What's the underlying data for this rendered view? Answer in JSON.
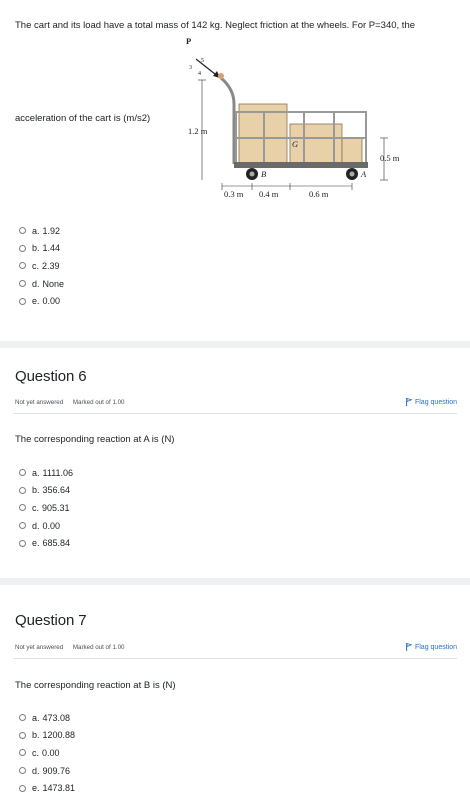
{
  "question5": {
    "text": "The cart and its load have a total mass of 142 kg. Neglect friction at the wheels. For P=340, the",
    "prompt": "acceleration of the cart is  (m/s2)",
    "answers": [
      {
        "letter": "a.",
        "value": "1.92"
      },
      {
        "letter": "b.",
        "value": "1.44"
      },
      {
        "letter": "c.",
        "value": "2.39"
      },
      {
        "letter": "d.",
        "value": "None"
      },
      {
        "letter": "e.",
        "value": "0.00"
      }
    ],
    "figure": {
      "force_label": "P",
      "slope_a": "3",
      "slope_b": "5",
      "slope_c": "4",
      "height_label": "1.2 m",
      "cg_label": "G",
      "wheel_b_label": "B",
      "wheel_a_label": "A",
      "side_label": "0.5 m",
      "dim1": "0.3 m",
      "dim2": "0.4 m",
      "dim3": "0.6 m"
    }
  },
  "question6": {
    "title": "Question 6",
    "status": "Not yet answered",
    "marked": "Marked out of 1.00",
    "flag": "Flag question",
    "text": "The corresponding reaction at A is  (N)",
    "answers": [
      {
        "letter": "a.",
        "value": "1111.06"
      },
      {
        "letter": "b.",
        "value": "356.64"
      },
      {
        "letter": "c.",
        "value": "905.31"
      },
      {
        "letter": "d.",
        "value": "0.00"
      },
      {
        "letter": "e.",
        "value": "685.84"
      }
    ]
  },
  "question7": {
    "title": "Question 7",
    "status": "Not yet answered",
    "marked": "Marked out of 1.00",
    "flag": "Flag question",
    "text": "The corresponding reaction at B is  (N)",
    "answers": [
      {
        "letter": "a.",
        "value": "473.08"
      },
      {
        "letter": "b.",
        "value": "1200.88"
      },
      {
        "letter": "c.",
        "value": "0.00"
      },
      {
        "letter": "d.",
        "value": "909.76"
      },
      {
        "letter": "e.",
        "value": "1473.81"
      }
    ]
  },
  "colors": {
    "link": "#2c6fc1",
    "separator": "#eef0f2",
    "text": "#1d2125"
  }
}
